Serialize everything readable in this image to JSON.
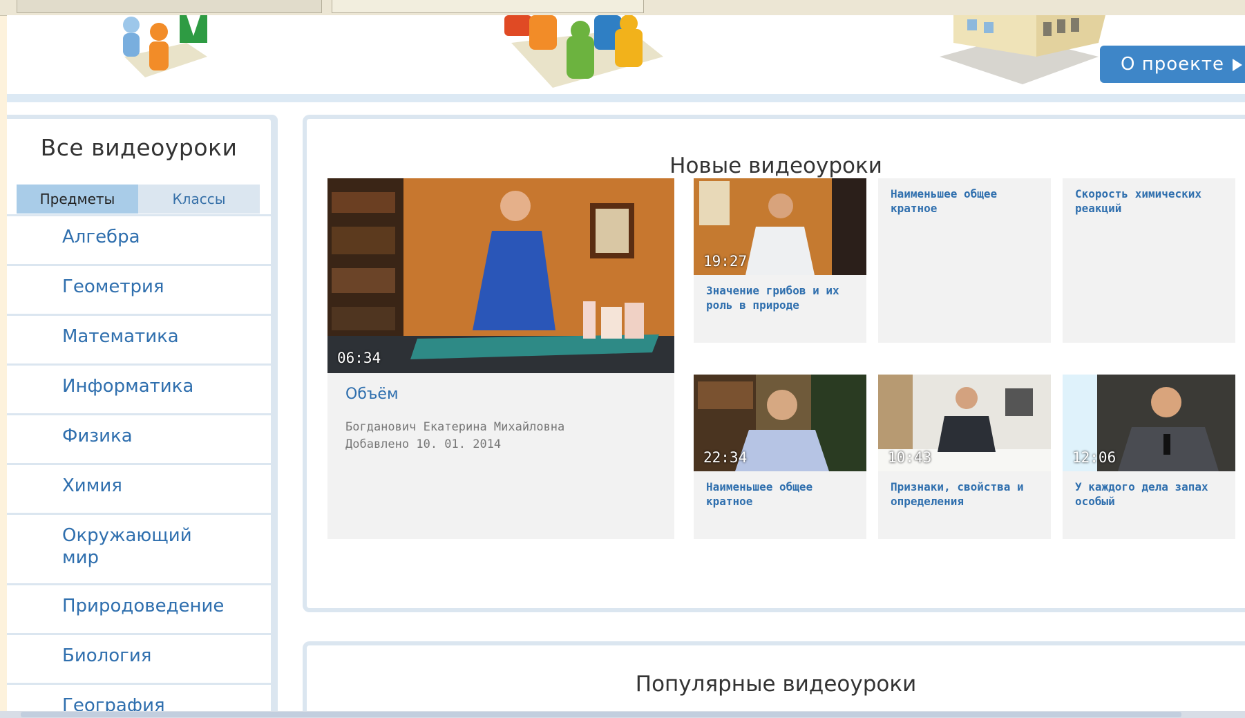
{
  "header": {
    "about_label": "О проекте"
  },
  "sidebar": {
    "title": "Все видеоуроки",
    "tabs": [
      {
        "label": "Предметы",
        "active": true
      },
      {
        "label": "Классы",
        "active": false
      }
    ],
    "items": [
      {
        "label": "Алгебра"
      },
      {
        "label": "Геометрия"
      },
      {
        "label": "Математика"
      },
      {
        "label": "Информатика"
      },
      {
        "label": "Физика"
      },
      {
        "label": "Химия"
      },
      {
        "label": "Окружающий мир"
      },
      {
        "label": "Природоведение"
      },
      {
        "label": "Биология"
      },
      {
        "label": "География"
      }
    ]
  },
  "main": {
    "new_title": "Новые видеоуроки",
    "featured": {
      "duration": "06:34",
      "title": "Объём",
      "author": "Богданович Екатерина Михайловна",
      "date": "Добавлено 10. 01. 2014"
    },
    "cards": [
      {
        "title": "Значение грибов и их роль в природе",
        "duration": "19:27"
      },
      {
        "title": "Наименьшее общее кратное",
        "duration": ""
      },
      {
        "title": "Скорость химических реакций",
        "duration": ""
      },
      {
        "title": "Наименьшее общее кратное",
        "duration": "22:34"
      },
      {
        "title": "Признаки, свойства и определения",
        "duration": "10:43"
      },
      {
        "title": "У каждого дела запах особый",
        "duration": "12:06"
      }
    ],
    "popular_title": "Популярные видеоуроки"
  },
  "colors": {
    "accent": "#3e86c8",
    "link": "#2f6fae",
    "panel_border": "#dbe6f0",
    "active_tab": "#a9cce8",
    "card_bg": "#f2f2f2"
  }
}
